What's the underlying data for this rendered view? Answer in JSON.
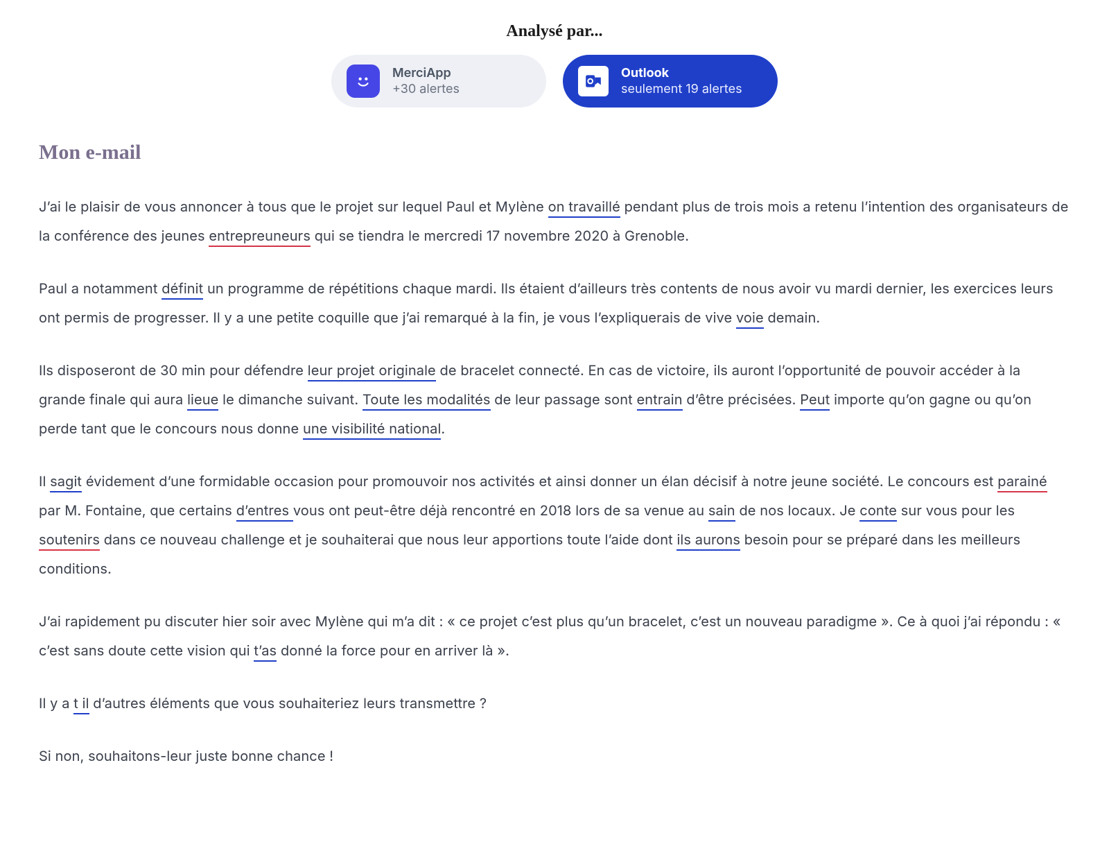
{
  "header": {
    "analysed_by": "Analysé par..."
  },
  "apps": {
    "merciapp": {
      "name": "MerciApp",
      "sub": "+30 alertes"
    },
    "outlook": {
      "name": "Outlook",
      "sub": "seulement 19 alertes"
    }
  },
  "mail": {
    "title": "Mon e-mail",
    "p1": {
      "t0": "J’ai le plaisir de vous annoncer à tous que le projet sur lequel Paul et Mylène ",
      "e1": "on travaillé",
      "t1": " pendant plus de trois mois a retenu l’intention des organisateurs de la conférence des jeunes ",
      "e2": "entrepreuneurs",
      "t2": " qui se tiendra le mercredi 17 novembre 2020 à Grenoble."
    },
    "p2": {
      "t0": "Paul a notamment ",
      "e1": "définit",
      "t1": " un programme de répétitions chaque mardi. Ils étaient d’ailleurs très contents de nous avoir vu mardi dernier, les exercices leurs ont permis de progresser. Il y a une petite coquille que j’ai remarqué à la fin, je vous l’expliquerais de vive ",
      "e2": "voie",
      "t2": " demain."
    },
    "p3": {
      "t0": "Ils disposeront de 30 min pour défendre ",
      "e1": "leur projet originale",
      "t1": " de bracelet connecté. En cas de victoire, ils auront l’opportunité de pouvoir accéder à la grande finale qui aura ",
      "e2": "lieue",
      "t2": " le dimanche suivant. ",
      "e3": "Toute les modalités",
      "t3": " de leur passage sont ",
      "e4": "entrain",
      "t4": " d’être précisées. ",
      "e5": "Peut",
      "t5": " importe qu’on gagne ou qu’on perde tant que le concours nous donne ",
      "e6": "une visibilité national",
      "t6": "."
    },
    "p4": {
      "t0": "Il ",
      "e1": "sagit",
      "t1": " évidement d’une formidable occasion pour promouvoir nos activités et ainsi donner un élan décisif à notre jeune société. Le concours est ",
      "e2": "parainé",
      "t2": " par M. Fontaine, que certains ",
      "e3": "d’entres ",
      "t3": "vous ont peut-être déjà rencontré en 2018 lors de sa venue au ",
      "e4": "sain",
      "t4": " de nos locaux. Je ",
      "e5": "conte",
      "t5": " sur vous pour les ",
      "e6": "soutenirs",
      "t6": " dans ce nouveau challenge et je souhaiterai que nous leur apportions toute l’aide dont ",
      "e7": "ils aurons",
      "t7": " besoin pour se préparé dans les meilleurs conditions."
    },
    "p5": {
      "t0": "J’ai rapidement pu discuter hier soir avec Mylène qui m’a dit : « ce projet c’est plus qu’un bracelet, c’est un nouveau paradigme ». Ce à quoi j’ai répondu : « c’est sans doute cette vision qui ",
      "e1": "t’as",
      "t1": " donné la force pour en arriver là »."
    },
    "p6": {
      "t0": "Il y a ",
      "e1": "t il",
      "t1": " d’autres éléments que vous souhaiteriez leurs transmettre ?"
    },
    "p7": {
      "t0": "Si non, souhaitons-leur juste bonne chance !"
    }
  }
}
